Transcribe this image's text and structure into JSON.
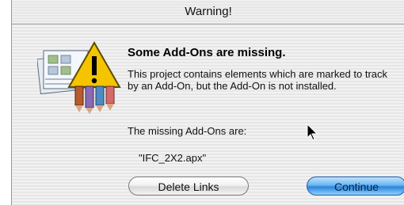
{
  "window": {
    "title": "Warning!"
  },
  "alert": {
    "heading": "Some Add-Ons are missing.",
    "message": "This project contains elements which are marked to track by an Add-On, but the Add-On is not installed.",
    "missing_label": "The missing Add-Ons are:",
    "missing_items": [
      "\"IFC_2X2.apx\""
    ]
  },
  "buttons": {
    "delete_links": "Delete Links",
    "continue": "Continue"
  },
  "icons": {
    "alert": "warning-triangle-icon",
    "cursor": "mouse-pointer-icon"
  },
  "colors": {
    "default_button": "#2a86dd",
    "warning": "#f2c300"
  }
}
